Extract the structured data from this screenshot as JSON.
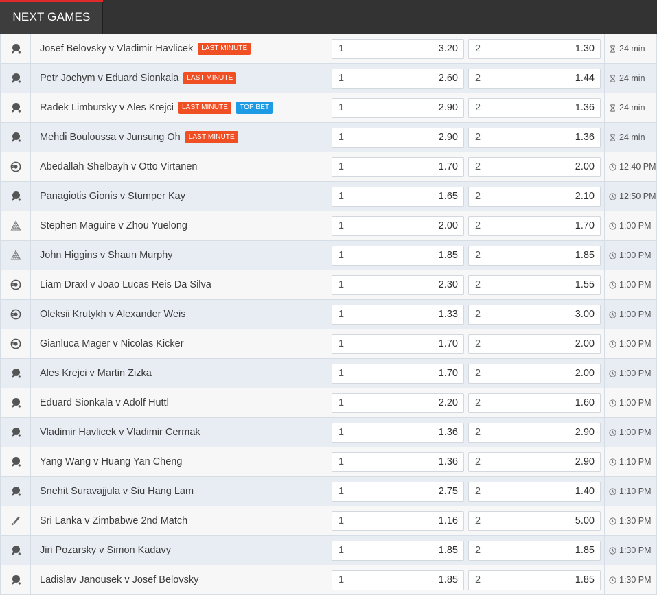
{
  "header": {
    "tab_label": "NEXT GAMES",
    "accent_color": "#e02a2a"
  },
  "games": [
    {
      "sport": "table-tennis",
      "name": "Josef Belovsky v Vladimir Havlicek",
      "badges": [
        "LAST MINUTE"
      ],
      "o1_label": "1",
      "o1": "3.20",
      "o2_label": "2",
      "o2": "1.30",
      "time_icon": "hourglass",
      "time": "24 min"
    },
    {
      "sport": "table-tennis",
      "name": "Petr Jochym v Eduard Sionkala",
      "badges": [
        "LAST MINUTE"
      ],
      "o1_label": "1",
      "o1": "2.60",
      "o2_label": "2",
      "o2": "1.44",
      "time_icon": "hourglass",
      "time": "24 min"
    },
    {
      "sport": "table-tennis",
      "name": "Radek Limbursky v Ales Krejci",
      "badges": [
        "LAST MINUTE",
        "TOP BET"
      ],
      "o1_label": "1",
      "o1": "2.90",
      "o2_label": "2",
      "o2": "1.36",
      "time_icon": "hourglass",
      "time": "24 min"
    },
    {
      "sport": "table-tennis",
      "name": "Mehdi Bouloussa v Junsung Oh",
      "badges": [
        "LAST MINUTE"
      ],
      "o1_label": "1",
      "o1": "2.90",
      "o2_label": "2",
      "o2": "1.36",
      "time_icon": "hourglass",
      "time": "24 min"
    },
    {
      "sport": "tennis",
      "name": "Abedallah Shelbayh v Otto Virtanen",
      "badges": [],
      "o1_label": "1",
      "o1": "1.70",
      "o2_label": "2",
      "o2": "2.00",
      "time_icon": "clock",
      "time": "12:40 PM"
    },
    {
      "sport": "table-tennis",
      "name": "Panagiotis Gionis v Stumper Kay",
      "badges": [],
      "o1_label": "1",
      "o1": "1.65",
      "o2_label": "2",
      "o2": "2.10",
      "time_icon": "clock",
      "time": "12:50 PM"
    },
    {
      "sport": "snooker",
      "name": "Stephen Maguire v Zhou Yuelong",
      "badges": [],
      "o1_label": "1",
      "o1": "2.00",
      "o2_label": "2",
      "o2": "1.70",
      "time_icon": "clock",
      "time": "1:00 PM"
    },
    {
      "sport": "snooker",
      "name": "John Higgins v Shaun Murphy",
      "badges": [],
      "o1_label": "1",
      "o1": "1.85",
      "o2_label": "2",
      "o2": "1.85",
      "time_icon": "clock",
      "time": "1:00 PM"
    },
    {
      "sport": "tennis",
      "name": "Liam Draxl v Joao Lucas Reis Da Silva",
      "badges": [],
      "o1_label": "1",
      "o1": "2.30",
      "o2_label": "2",
      "o2": "1.55",
      "time_icon": "clock",
      "time": "1:00 PM"
    },
    {
      "sport": "tennis",
      "name": "Oleksii Krutykh v Alexander Weis",
      "badges": [],
      "o1_label": "1",
      "o1": "1.33",
      "o2_label": "2",
      "o2": "3.00",
      "time_icon": "clock",
      "time": "1:00 PM"
    },
    {
      "sport": "tennis",
      "name": "Gianluca Mager v Nicolas Kicker",
      "badges": [],
      "o1_label": "1",
      "o1": "1.70",
      "o2_label": "2",
      "o2": "2.00",
      "time_icon": "clock",
      "time": "1:00 PM"
    },
    {
      "sport": "table-tennis",
      "name": "Ales Krejci v Martin Zizka",
      "badges": [],
      "o1_label": "1",
      "o1": "1.70",
      "o2_label": "2",
      "o2": "2.00",
      "time_icon": "clock",
      "time": "1:00 PM"
    },
    {
      "sport": "table-tennis",
      "name": "Eduard Sionkala v Adolf Huttl",
      "badges": [],
      "o1_label": "1",
      "o1": "2.20",
      "o2_label": "2",
      "o2": "1.60",
      "time_icon": "clock",
      "time": "1:00 PM"
    },
    {
      "sport": "table-tennis",
      "name": "Vladimir Havlicek v Vladimir Cermak",
      "badges": [],
      "o1_label": "1",
      "o1": "1.36",
      "o2_label": "2",
      "o2": "2.90",
      "time_icon": "clock",
      "time": "1:00 PM"
    },
    {
      "sport": "table-tennis",
      "name": "Yang Wang v Huang Yan Cheng",
      "badges": [],
      "o1_label": "1",
      "o1": "1.36",
      "o2_label": "2",
      "o2": "2.90",
      "time_icon": "clock",
      "time": "1:10 PM"
    },
    {
      "sport": "table-tennis",
      "name": "Snehit Suravajjula v Siu Hang Lam",
      "badges": [],
      "o1_label": "1",
      "o1": "2.75",
      "o2_label": "2",
      "o2": "1.40",
      "time_icon": "clock",
      "time": "1:10 PM"
    },
    {
      "sport": "cricket",
      "name": "Sri Lanka v Zimbabwe 2nd Match",
      "badges": [],
      "o1_label": "1",
      "o1": "1.16",
      "o2_label": "2",
      "o2": "5.00",
      "time_icon": "clock",
      "time": "1:30 PM"
    },
    {
      "sport": "table-tennis",
      "name": "Jiri Pozarsky v Simon Kadavy",
      "badges": [],
      "o1_label": "1",
      "o1": "1.85",
      "o2_label": "2",
      "o2": "1.85",
      "time_icon": "clock",
      "time": "1:30 PM"
    },
    {
      "sport": "table-tennis",
      "name": "Ladislav Janousek v Josef Belovsky",
      "badges": [],
      "o1_label": "1",
      "o1": "1.85",
      "o2_label": "2",
      "o2": "1.85",
      "time_icon": "clock",
      "time": "1:30 PM"
    }
  ],
  "badge_colors": {
    "LAST MINUTE": "#f04e23",
    "TOP BET": "#1d9be5"
  }
}
